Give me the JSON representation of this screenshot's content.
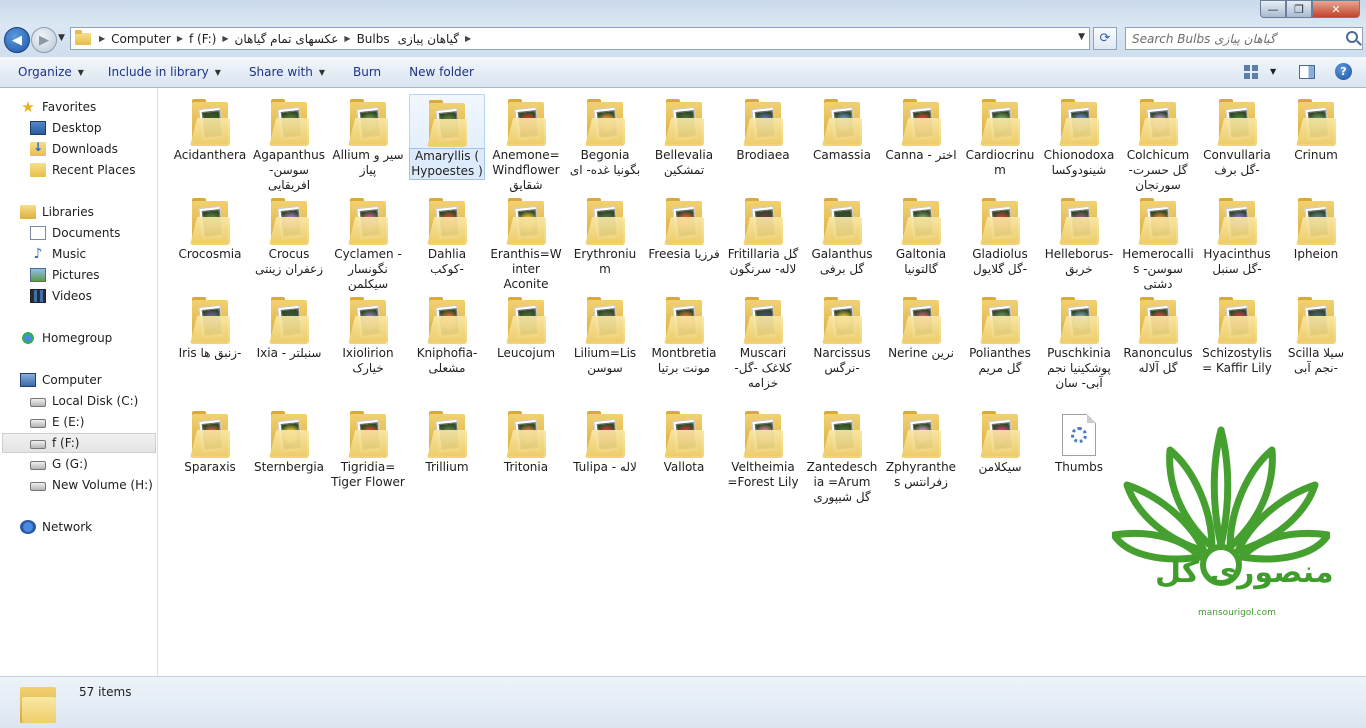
{
  "window": {
    "minimize": "—",
    "maximize": "❐",
    "close": "✕"
  },
  "address": {
    "crumbs": [
      "Computer",
      "f (F:)",
      "عکسهای تمام گیاهان",
      "Bulbs",
      "گیاهان پیازی"
    ],
    "search_placeholder": "Search Bulbs  گیاهان پیازی"
  },
  "toolbar": {
    "organize": "Organize",
    "include": "Include in library",
    "share": "Share with",
    "burn": "Burn",
    "new_folder": "New folder",
    "help": "?"
  },
  "nav": {
    "favorites": "Favorites",
    "desktop": "Desktop",
    "downloads": "Downloads",
    "recent": "Recent Places",
    "libraries": "Libraries",
    "documents": "Documents",
    "music": "Music",
    "pictures": "Pictures",
    "videos": "Videos",
    "homegroup": "Homegroup",
    "computer": "Computer",
    "drive_c": "Local Disk (C:)",
    "drive_e": "E (E:)",
    "drive_f": "f (F:)",
    "drive_g": "G (G:)",
    "drive_h": "New Volume (H:)",
    "network": "Network"
  },
  "items": [
    {
      "label": "Acidanthera",
      "color": "#3b5a2a"
    },
    {
      "label": "Agapanthus سوسن- افریقایی",
      "color": "#5a7a3a"
    },
    {
      "label": "Allium  سیر و پیاز",
      "color": "#6a8a4a"
    },
    {
      "label": "Amaryllis ( Hypoestes )",
      "color": "#5e7d3c"
    },
    {
      "label": "Anemone=Windflower شقایق",
      "color": "#c23a2a"
    },
    {
      "label": "Begonia بگونیا غده- ای",
      "color": "#d88a3a"
    },
    {
      "label": "Bellevalia تمشکین",
      "color": "#4a6a3a"
    },
    {
      "label": "Brodiaea",
      "color": "#5a6ab0"
    },
    {
      "label": "Camassia",
      "color": "#6a8ac0"
    },
    {
      "label": "Canna - اختر",
      "color": "#d04030"
    },
    {
      "label": "Cardiocrinum",
      "color": "#7a9a5a"
    },
    {
      "label": "Chionodoxa شینودوکسا",
      "color": "#7080d0"
    },
    {
      "label": "Colchicum گل حسرت- سورنجان",
      "color": "#b08ac0"
    },
    {
      "label": "Convullaria گل برف-",
      "color": "#4a7a3a"
    },
    {
      "label": "Crinum",
      "color": "#6a8a5a"
    },
    {
      "label": "Crocosmia",
      "color": "#5a7a3a"
    },
    {
      "label": "Crocus زعفران زینتی",
      "color": "#9a70c0"
    },
    {
      "label": "Cyclamen - نگونسار سیکلمن",
      "color": "#c05a8a"
    },
    {
      "label": "Dahlia کوکب-",
      "color": "#c04a3a"
    },
    {
      "label": "Eranthis=Winter Aconite",
      "color": "#d0b030"
    },
    {
      "label": "Erythronium",
      "color": "#4a6a4a"
    },
    {
      "label": "Freesia فرزیا",
      "color": "#d05a3a"
    },
    {
      "label": "Fritillaria گل لاله- سرنگون",
      "color": "#6a3a4a"
    },
    {
      "label": "Galanthus گل برفی",
      "color": "#3a4a3a"
    },
    {
      "label": "Galtonia گالتونیا",
      "color": "#7a9a6a"
    },
    {
      "label": "Gladiolus گل گلایول-",
      "color": "#c04040"
    },
    {
      "label": "Helleborus- خربق",
      "color": "#8a5a7a"
    },
    {
      "label": "Hemerocallis سوسن- دشتی",
      "color": "#d07a3a"
    },
    {
      "label": "Hyacinthus گل سنبل-",
      "color": "#7a6ac0"
    },
    {
      "label": "Ipheion",
      "color": "#5a7a8a"
    },
    {
      "label": "Iris  زنبق ها-",
      "color": "#6a5ab0"
    },
    {
      "label": "Ixia - سنبلتر",
      "color": "#3a5a3a"
    },
    {
      "label": "Ixiolirion خیارک",
      "color": "#8a7ab0"
    },
    {
      "label": "Kniphofia- مشعلی",
      "color": "#d06a2a"
    },
    {
      "label": "Leucojum",
      "color": "#4a6a3a"
    },
    {
      "label": "Lilium=Lis سوسن",
      "color": "#5a6a4a"
    },
    {
      "label": "Montbretia مونت برتیا",
      "color": "#d07030"
    },
    {
      "label": "Muscari کلاغک -گل- خزامه",
      "color": "#4a4a8a"
    },
    {
      "label": "Narcissus نرگس-",
      "color": "#d0b040"
    },
    {
      "label": "Nerine نرین",
      "color": "#c05a7a"
    },
    {
      "label": "Polianthes گل مریم",
      "color": "#6a8a5a"
    },
    {
      "label": "Puschkinia پوشکینیا نجم آبی- سان",
      "color": "#7a9ab0"
    },
    {
      "label": "Ranonculus گل آلاله",
      "color": "#c04a3a"
    },
    {
      "label": "Schizostylis = Kaffir Lily",
      "color": "#c03a4a"
    },
    {
      "label": "Scilla  سیلا نجم آبی-",
      "color": "#4a5a8a"
    },
    {
      "label": "Sparaxis",
      "color": "#c05a3a"
    },
    {
      "label": "Sternbergia",
      "color": "#d0b030"
    },
    {
      "label": "Tigridia= Tiger Flower",
      "color": "#c04a2a"
    },
    {
      "label": "Trillium",
      "color": "#5a7a4a"
    },
    {
      "label": "Tritonia",
      "color": "#c07040"
    },
    {
      "label": "Tulipa - لاله",
      "color": "#c03a3a"
    },
    {
      "label": "Vallota",
      "color": "#b03a3a"
    },
    {
      "label": "Veltheimia =Forest Lily",
      "color": "#c07a8a"
    },
    {
      "label": "Zantedeschia =Arum گل شیپوری",
      "color": "#4a6a3a"
    },
    {
      "label": "Zphyranthes  زفرانتس",
      "color": "#c08ab0"
    },
    {
      "label": "سیکلامن",
      "color": "#c03a7a"
    }
  ],
  "thumbs": {
    "label": "Thumbs"
  },
  "details": {
    "count": "57 items"
  },
  "logo": {
    "text": "منصوری گل",
    "url": "mansourigol.com"
  }
}
